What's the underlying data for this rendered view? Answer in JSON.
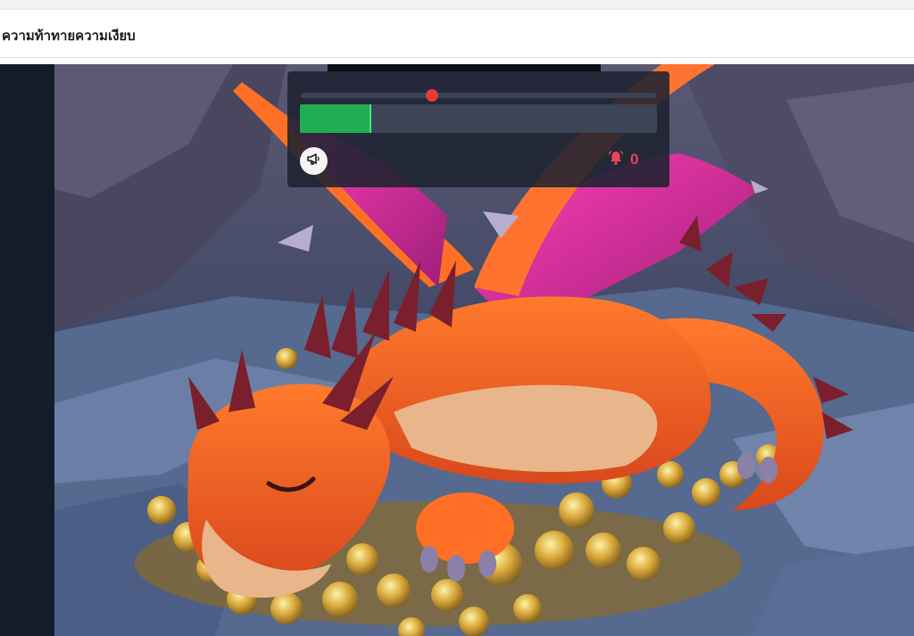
{
  "page": {
    "title": "ความท้าทายความเงียบ"
  },
  "game": {
    "scene_name": "sleeping-dragon-on-treasure",
    "hud": {
      "slider_level_fraction": 0.37,
      "meter_fill_fraction": 0.195,
      "alert_count": "0",
      "slider_color": "#e53b3b",
      "meter_color": "#1fae55",
      "alert_color": "#e8445a",
      "icons": {
        "announce": "megaphone-icon",
        "alert": "bell-alert-icon"
      }
    }
  }
}
